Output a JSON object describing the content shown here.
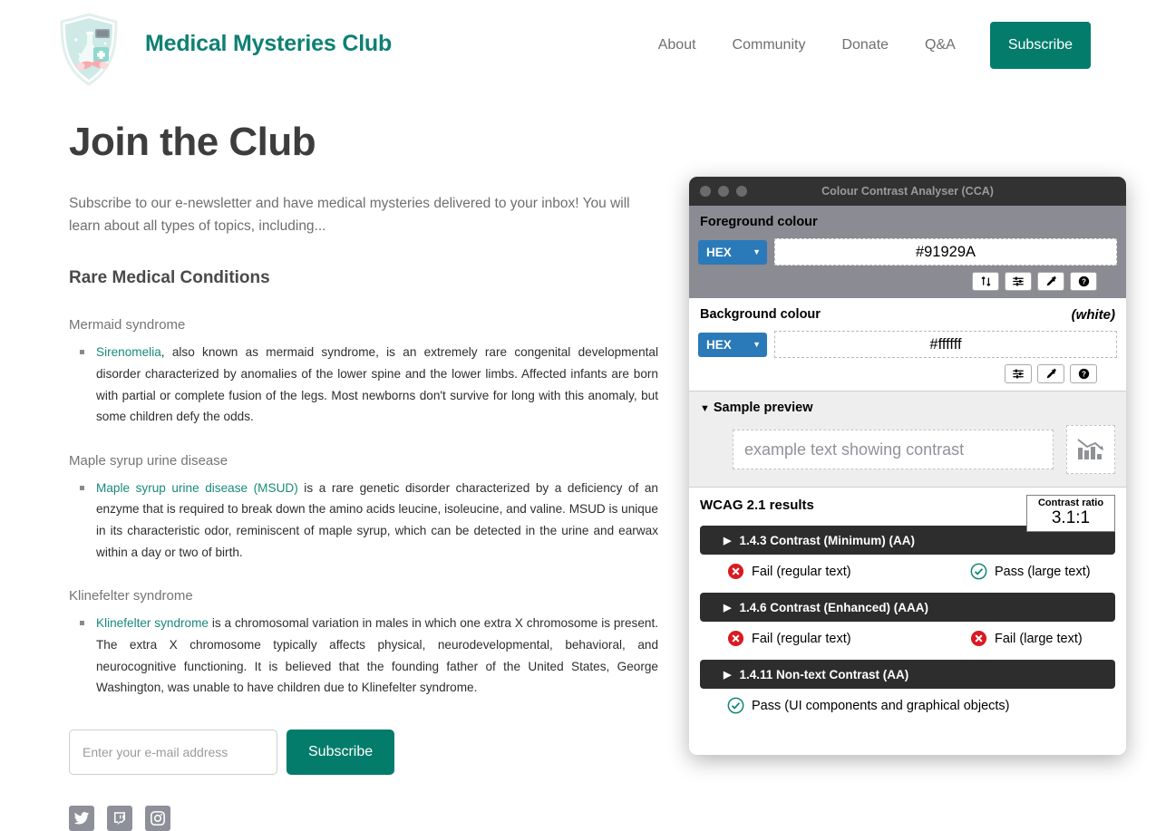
{
  "site": {
    "brand": "Medical Mysteries Club",
    "logo_icon": "shield-lab-logo",
    "nav": [
      {
        "label": "About",
        "name": "nav-about"
      },
      {
        "label": "Community",
        "name": "nav-community"
      },
      {
        "label": "Donate",
        "name": "nav-donate"
      },
      {
        "label": "Q&A",
        "name": "nav-qa"
      }
    ],
    "subscribe_top_label": "Subscribe",
    "accent_color": "#047c6c"
  },
  "main": {
    "page_title": "Join the Club",
    "intro": "Subscribe to our e-newsletter and have medical mysteries delivered to your inbox! You will learn about all types of topics, including...",
    "section_title": "Rare Medical Conditions",
    "conditions": [
      {
        "heading": "Mermaid syndrome",
        "link_text": "Sirenomelia",
        "body": ", also known as mermaid syndrome, is an extremely rare congenital developmental disorder characterized by anomalies of the lower spine and the lower limbs. Affected infants are born with partial or complete fusion of the legs. Most newborns don't survive for long with this anomaly, but some children defy the odds."
      },
      {
        "heading": "Maple syrup urine disease",
        "link_text": "Maple syrup urine disease (MSUD)",
        "body": " is a rare genetic disorder characterized by a deficiency of an enzyme that is required to break down the amino acids leucine, isoleucine, and valine. MSUD is unique in its characteristic odor, reminiscent of maple syrup, which can be detected in the urine and earwax within a day or two of birth."
      },
      {
        "heading": "Klinefelter syndrome",
        "link_text": "Klinefelter syndrome",
        "body": " is a chromosomal variation in males in which one extra X chromosome is present. The extra X chromosome typically affects physical, neurodevelopmental, behavioral, and neurocognitive functioning. It is believed that the founding father of the United States, George Washington, was unable to have children due to Klinefelter syndrome."
      }
    ],
    "link_color": "#18897a"
  },
  "subscribe_form": {
    "email_value": "",
    "email_placeholder": "Enter your e-mail address",
    "button_label": "Subscribe"
  },
  "socials": [
    {
      "name": "twitter-icon",
      "label": "Twitter"
    },
    {
      "name": "twitch-icon",
      "label": "Twitch"
    },
    {
      "name": "instagram-icon",
      "label": "Instagram"
    }
  ],
  "cca": {
    "window_title": "Colour Contrast Analyser (CCA)",
    "foreground": {
      "label": "Foreground colour",
      "format": "HEX",
      "value": "#91929A",
      "buttons": [
        "swap-icon",
        "sliders-icon",
        "eyedropper-icon",
        "help-icon"
      ]
    },
    "background": {
      "label": "Background colour",
      "note": "(white)",
      "format": "HEX",
      "value": "#ffffff",
      "buttons": [
        "sliders-icon",
        "eyedropper-icon",
        "help-icon"
      ]
    },
    "preview": {
      "heading": "Sample preview",
      "expanded": true,
      "sample_text": "example text showing contrast",
      "chart_icon": "declining-bar-chart-icon"
    },
    "results": {
      "heading": "WCAG 2.1 results",
      "ratio_label": "Contrast ratio",
      "ratio_value": "3.1:1",
      "criteria": [
        {
          "title": "1.4.3 Contrast (Minimum) (AA)",
          "expanded": false,
          "results": [
            {
              "status": "fail",
              "label": "Fail (regular text)"
            },
            {
              "status": "pass",
              "label": "Pass (large text)"
            }
          ]
        },
        {
          "title": "1.4.6 Contrast (Enhanced) (AAA)",
          "expanded": false,
          "results": [
            {
              "status": "fail",
              "label": "Fail (regular text)"
            },
            {
              "status": "fail",
              "label": "Fail (large text)"
            }
          ]
        },
        {
          "title": "1.4.11 Non-text Contrast (AA)",
          "expanded": false,
          "results": [
            {
              "status": "pass",
              "label": "Pass (UI components and graphical objects)"
            }
          ]
        }
      ]
    }
  }
}
